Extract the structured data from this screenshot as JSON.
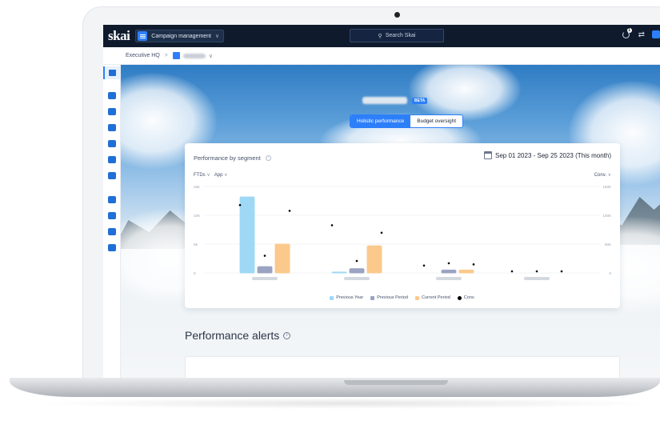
{
  "app": {
    "logo": "skai",
    "campaign_select": "Campaign management",
    "search_placeholder": "Search Skai",
    "notification_count": "1"
  },
  "breadcrumb": {
    "home": "Executive HQ",
    "separator": ">"
  },
  "hero": {
    "beta_badge": "BETA",
    "tabs": [
      {
        "label": "Holistic performance",
        "active": true
      },
      {
        "label": "Budget oversight",
        "active": false
      }
    ]
  },
  "performance_card": {
    "title": "Performance by segment",
    "date_range": "Sep 01 2023 - Sep 25 2023 (This month)",
    "filter_metric": "FTDs",
    "filter_dimension": "App",
    "secondary_metric": "Conv."
  },
  "chart_data": {
    "type": "bar",
    "categories": [
      "",
      "",
      "",
      ""
    ],
    "ylim_left": [
      0,
      15000
    ],
    "left_ticks": [
      "15K",
      "10K",
      "5K",
      "0"
    ],
    "ylim_right": [
      0,
      150000
    ],
    "right_ticks": [
      "150K",
      "100K",
      "50K",
      "0"
    ],
    "series": [
      {
        "name": "Previous Year",
        "color": "#9fd8f5",
        "values": [
          13200,
          150,
          0,
          0
        ]
      },
      {
        "name": "Previous Period",
        "color": "#9aa3c1",
        "values": [
          1100,
          750,
          500,
          0
        ]
      },
      {
        "name": "Current Period",
        "color": "#fbc98b",
        "values": [
          5000,
          4700,
          500,
          0
        ]
      }
    ],
    "dots": {
      "name": "Conv.",
      "color": "#000000",
      "values": [
        [
          115000,
          27000,
          105000
        ],
        [
          80000,
          18000,
          67000
        ],
        [
          10000,
          14000,
          12000
        ],
        [
          0,
          0,
          0
        ]
      ]
    },
    "legend_position": "bottom",
    "grid": true
  },
  "alerts": {
    "title": "Performance alerts"
  }
}
